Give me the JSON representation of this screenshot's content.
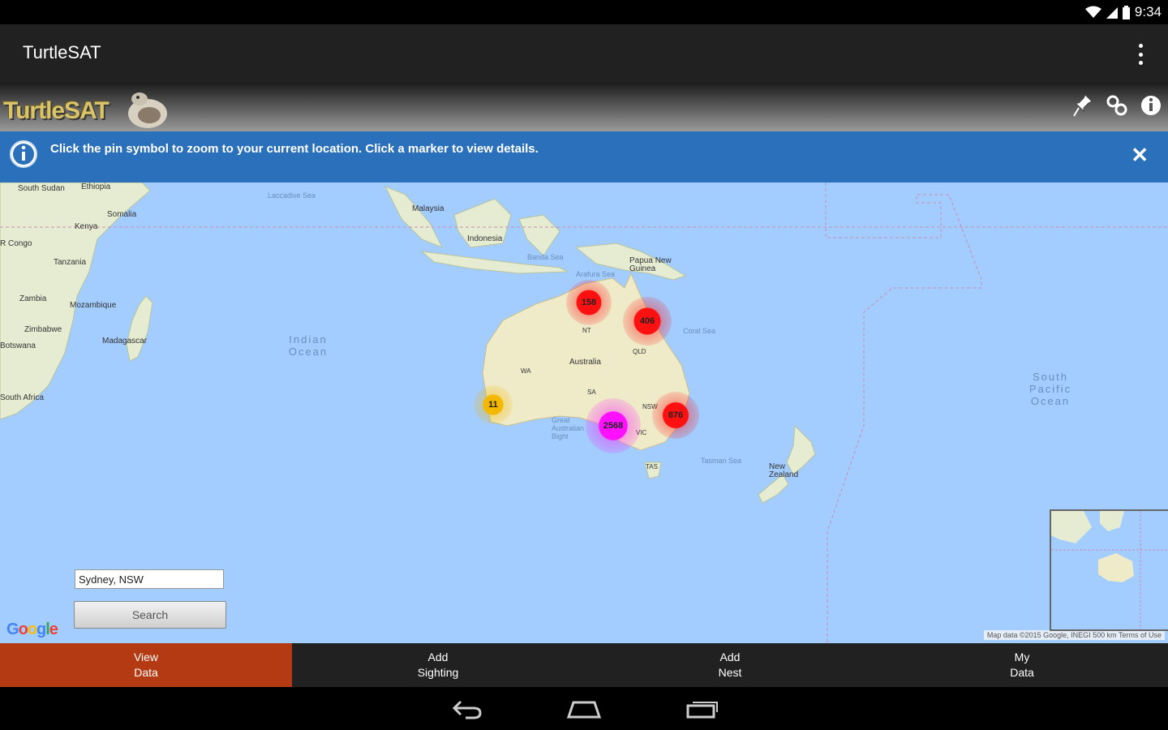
{
  "status_bar": {
    "time": "9:34",
    "icons": [
      "wifi-icon",
      "signal-icon",
      "battery-icon"
    ]
  },
  "app_bar": {
    "title": "TurtleSAT",
    "menu_icon": "overflow-menu-icon"
  },
  "banner": {
    "logo_text": "TurtleSAT",
    "icons": [
      "pin-icon",
      "link-icon",
      "info-icon"
    ]
  },
  "info_bar": {
    "message": "Click the pin symbol to zoom to your current location. Click a marker to view details.",
    "close_label": "✕"
  },
  "map": {
    "labels": {
      "south_sudan": "South Sudan",
      "ethiopia": "Ethiopia",
      "somalia": "Somalia",
      "kenya": "Kenya",
      "congo": "R Congo",
      "tanzania": "Tanzania",
      "zambia": "Zambia",
      "mozambique": "Mozambique",
      "zimbabwe": "Zimbabwe",
      "botswana": "Botswana",
      "madagascar": "Madagascar",
      "south_africa": "South Africa",
      "malaysia": "Malaysia",
      "indonesia": "Indonesia",
      "png": "Papua New Guinea",
      "australia": "Australia",
      "new_zealand": "New Zealand",
      "wa": "WA",
      "qld": "QLD",
      "sa": "SA",
      "nsw": "NSW",
      "vic": "VIC",
      "tas": "TAS",
      "nt": "NT",
      "laccadive_sea": "Laccadive Sea",
      "banda_sea": "Banda Sea",
      "arafura_sea": "Arafura Sea",
      "coral_sea": "Coral Sea",
      "tasman_sea": "Tasman Sea",
      "great_australian_bight": "Great Australian Bight",
      "indian_ocean": "Indian Ocean",
      "south_pacific": "South Pacific Ocean"
    },
    "clusters": [
      {
        "count": "158",
        "color": "#ff1111"
      },
      {
        "count": "406",
        "color": "#ff1111"
      },
      {
        "count": "11",
        "color": "#f5b800"
      },
      {
        "count": "2568",
        "color": "#ff11ff"
      },
      {
        "count": "876",
        "color": "#ff1111"
      }
    ],
    "search_value": "Sydney, NSW",
    "search_button": "Search",
    "google_logo": "Google",
    "attribution": "Map data ©2015 Google, INEGI   500 km      Terms of Use"
  },
  "bottom_nav": [
    {
      "line1": "View",
      "line2": "Data",
      "active": true
    },
    {
      "line1": "Add",
      "line2": "Sighting",
      "active": false
    },
    {
      "line1": "Add",
      "line2": "Nest",
      "active": false
    },
    {
      "line1": "My",
      "line2": "Data",
      "active": false
    }
  ]
}
